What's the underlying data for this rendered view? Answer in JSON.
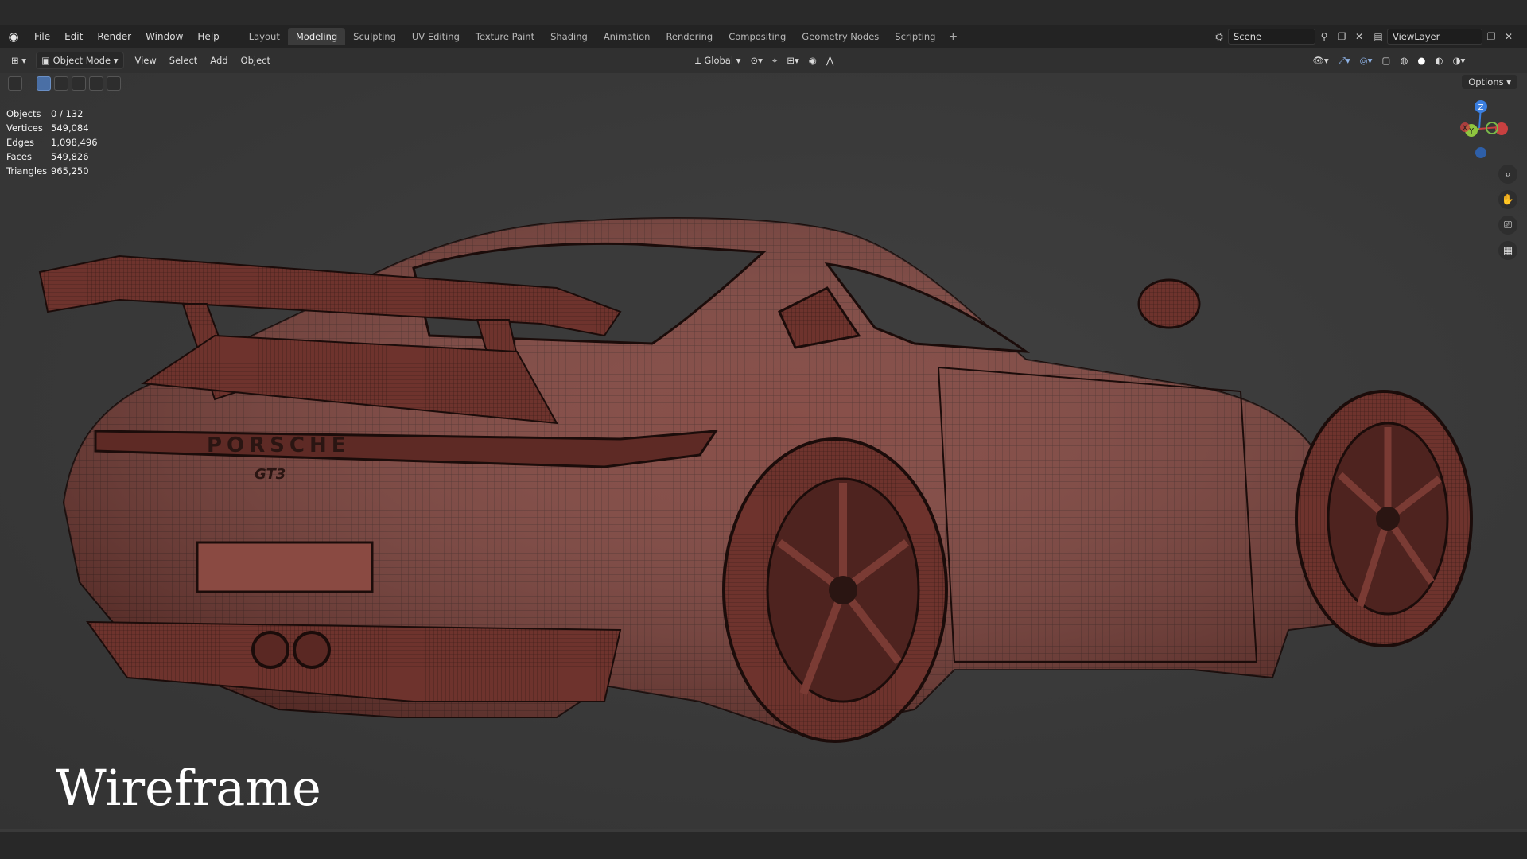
{
  "app": {
    "menu": [
      "File",
      "Edit",
      "Render",
      "Window",
      "Help"
    ],
    "workspaces": [
      "Layout",
      "Modeling",
      "Sculpting",
      "UV Editing",
      "Texture Paint",
      "Shading",
      "Animation",
      "Rendering",
      "Compositing",
      "Geometry Nodes",
      "Scripting"
    ],
    "active_workspace": "Modeling",
    "scene": "Scene",
    "view_layer": "ViewLayer"
  },
  "header": {
    "mode": "Object Mode",
    "menus": [
      "View",
      "Select",
      "Add",
      "Object"
    ],
    "orientation": "Global",
    "options": "Options"
  },
  "stats": [
    {
      "label": "Objects",
      "value": "0 / 132"
    },
    {
      "label": "Vertices",
      "value": "549,084"
    },
    {
      "label": "Edges",
      "value": "1,098,496"
    },
    {
      "label": "Faces",
      "value": "549,826"
    },
    {
      "label": "Triangles",
      "value": "965,250"
    }
  ],
  "gizmo": {
    "z": "Z",
    "y": "Y",
    "x": "X"
  },
  "caption": "Wireframe",
  "colors": {
    "model": "#7a3b34",
    "wire": "#2a1512",
    "accent": "#4a6fa5"
  }
}
